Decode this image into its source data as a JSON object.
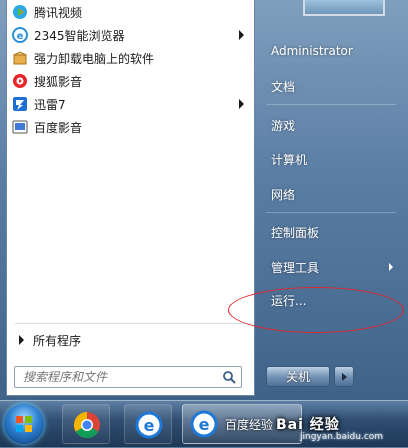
{
  "programs": [
    {
      "label": "腾讯视频",
      "icon": "tencent-video-icon",
      "has_submenu": false
    },
    {
      "label": "2345智能浏览器",
      "icon": "browser-2345-icon",
      "has_submenu": true
    },
    {
      "label": "强力卸载电脑上的软件",
      "icon": "uninstall-box-icon",
      "has_submenu": false
    },
    {
      "label": "搜狐影音",
      "icon": "sohu-video-icon",
      "has_submenu": false
    },
    {
      "label": "迅雷7",
      "icon": "xunlei-icon",
      "has_submenu": true
    },
    {
      "label": "百度影音",
      "icon": "baidu-video-icon",
      "has_submenu": false
    }
  ],
  "all_programs": "所有程序",
  "search": {
    "placeholder": "搜索程序和文件"
  },
  "right_items": [
    {
      "label": "Administrator"
    },
    {
      "label": "文档"
    },
    {
      "label": "游戏"
    },
    {
      "label": "计算机"
    },
    {
      "label": "网络"
    },
    {
      "label": "控制面板"
    },
    {
      "label": "管理工具",
      "has_submenu": true
    },
    {
      "label": "运行..."
    }
  ],
  "shutdown_label": "关机",
  "taskbar": {
    "active_label": "百度经验",
    "watermark": "Bai 经验",
    "watermark_site": "jingyan.baidu.com"
  },
  "colors": {
    "highlight_ellipse": "#e0262a",
    "menu_glass": "#5a7da4"
  }
}
